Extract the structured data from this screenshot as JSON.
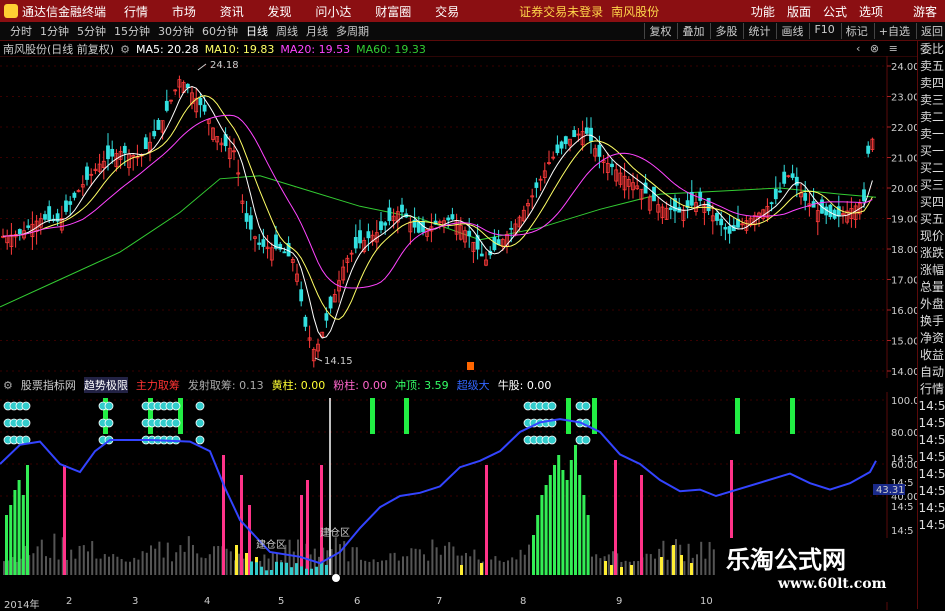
{
  "titlebar": {
    "app": "通达信金融终端",
    "menu": [
      "行情",
      "市场",
      "资讯",
      "发现",
      "问小达",
      "财富圈",
      "交易"
    ],
    "warning": "证券交易未登录",
    "stock": "南风股份",
    "right": [
      "功能",
      "版面",
      "公式",
      "选项",
      "游客"
    ]
  },
  "toolbar": {
    "periods": [
      "分时",
      "1分钟",
      "5分钟",
      "15分钟",
      "30分钟",
      "60分钟",
      "日线",
      "周线",
      "月线",
      "多周期"
    ],
    "active": "日线",
    "right": [
      "复权",
      "叠加",
      "多股",
      "统计",
      "画线",
      "F10",
      "标记",
      "+自选",
      "返回"
    ]
  },
  "info": {
    "name": "南风股份(日线 前复权)",
    "ma5": "MA5: 20.28",
    "ma10": "MA10: 19.83",
    "ma20": "MA20: 19.53",
    "ma60": "MA60: 19.33"
  },
  "price_axis": [
    "24.00",
    "23.00",
    "22.00",
    "21.00",
    "20.00",
    "19.00",
    "18.00",
    "17.00",
    "16.00",
    "15.00",
    "14.00"
  ],
  "annotations": {
    "high": "24.18",
    "low": "14.15"
  },
  "indicator": {
    "name": "股票指标网",
    "items": [
      {
        "label": "趋势极限",
        "color": "#ffffff"
      },
      {
        "label": "主力取筹",
        "color": "#ff3333"
      },
      {
        "label": "发射取筹: 0.13",
        "color": "#aaaaaa"
      },
      {
        "label": "黄柱: 0.00",
        "color": "#ffff33"
      },
      {
        "label": "粉柱: 0.00",
        "color": "#ff66cc"
      },
      {
        "label": "冲顶: 3.59",
        "color": "#33ff66"
      },
      {
        "label": "超级大",
        "color": "#3366ff"
      },
      {
        "label": "牛股: 0.00",
        "color": "#ffffff"
      }
    ],
    "axis": [
      "100.00",
      "80.00",
      "60.00",
      "40.00"
    ],
    "current_value": "43.31",
    "labels": {
      "build1": "建仓区",
      "build2": "建仓区"
    }
  },
  "side_panel": [
    "委比",
    "卖五",
    "卖四",
    "卖三",
    "卖二",
    "卖一",
    "买一",
    "买二",
    "买三",
    "买四",
    "买五",
    "现价",
    "涨跌",
    "涨幅",
    "总量",
    "外盘",
    "换手",
    "净资",
    "收益",
    "自动",
    "行情",
    "14:5",
    "14:5",
    "14:5",
    "14:5",
    "14:5",
    "14:5",
    "14:5",
    "14:5"
  ],
  "xaxis": [
    "2014年",
    "2",
    "3",
    "4",
    "5",
    "6",
    "7",
    "8",
    "9",
    "10"
  ],
  "watermark": {
    "line1": "乐淘公式网",
    "line2": "www.60lt.com"
  },
  "colors": {
    "up": "#ff3b3b",
    "down": "#33e0e0",
    "ma5": "#ffffff",
    "ma10": "#ffff66",
    "ma20": "#ff44ff",
    "ma60": "#33cc33",
    "trend": "#3344ff"
  }
}
